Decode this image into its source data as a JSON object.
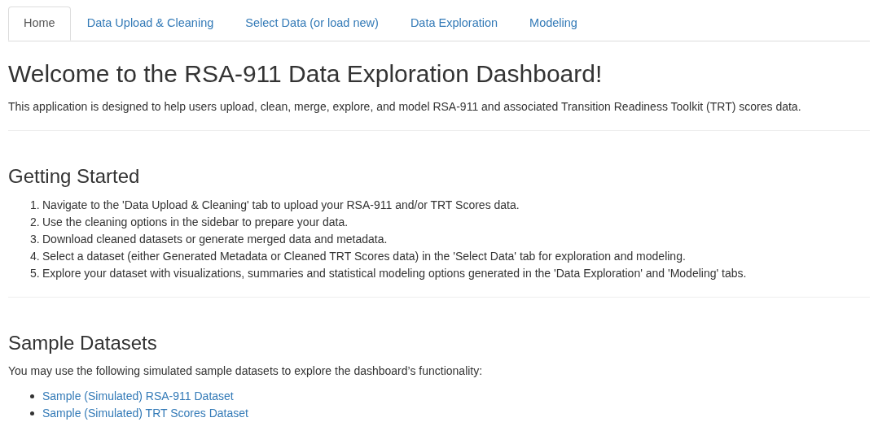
{
  "tabs": [
    {
      "label": "Home",
      "selected": true
    },
    {
      "label": "Data Upload & Cleaning",
      "selected": false
    },
    {
      "label": "Select Data (or load new)",
      "selected": false
    },
    {
      "label": "Data Exploration",
      "selected": false
    },
    {
      "label": "Modeling",
      "selected": false
    }
  ],
  "title": "Welcome to the RSA-911 Data Exploration Dashboard!",
  "intro": "This application is designed to help users upload, clean, merge, explore, and model RSA-911 and associated Transition Readiness Toolkit (TRT) scores data.",
  "getting_started": {
    "heading": "Getting Started",
    "steps": [
      {
        "number": "1.",
        "text": "Navigate to the 'Data Upload & Cleaning' tab to upload your RSA-911 and/or TRT Scores data."
      },
      {
        "number": "2.",
        "text": "Use the cleaning options in the sidebar to prepare your data."
      },
      {
        "number": "3.",
        "text": "Download cleaned datasets or generate merged data and metadata."
      },
      {
        "number": "4.",
        "text": "Select a dataset (either Generated Metadata or Cleaned TRT Scores data) in the 'Select Data' tab for exploration and modeling."
      },
      {
        "number": "5.",
        "text": "Explore your dataset with visualizations, summaries and statistical modeling options generated in the 'Data Exploration' and 'Modeling' tabs."
      }
    ]
  },
  "sample_datasets": {
    "heading": "Sample Datasets",
    "text": "You may use the following simulated sample datasets to explore the dashboard’s functionality:",
    "links": [
      "Sample (Simulated) RSA-911 Dataset",
      "Sample (Simulated) TRT Scores Dataset"
    ]
  }
}
